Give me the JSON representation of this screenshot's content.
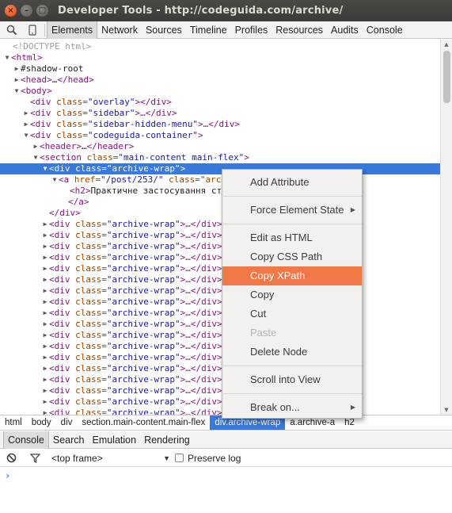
{
  "window": {
    "title": "Developer Tools - http://codeguida.com/archive/",
    "close_glyph": "×",
    "min_glyph": "–",
    "max_glyph": "□"
  },
  "toolbar": {
    "icons": [
      "search-icon",
      "device-mode-icon"
    ],
    "tabs": [
      "Elements",
      "Network",
      "Sources",
      "Timeline",
      "Profiles",
      "Resources",
      "Audits",
      "Console"
    ],
    "active_tab": "Elements"
  },
  "dom_tree": {
    "r0": {
      "a": "",
      "p1": "<!DOCTYPE html>"
    },
    "r1": {
      "a": "▼",
      "p1": "<html>"
    },
    "r2": {
      "a": "▶",
      "p1": "#shadow-root"
    },
    "r3": {
      "a": "▶",
      "p1": "<head>",
      "p2": "…",
      "p3": "</head>"
    },
    "r4": {
      "a": "▼",
      "p1": "<body>"
    },
    "r5": {
      "a": "",
      "p1": "<div ",
      "p2": "class=",
      "p3": "\"overlay\"",
      "p4": "></div>"
    },
    "r6": {
      "a": "▶",
      "p1": "<div ",
      "p2": "class=",
      "p3": "\"sidebar\"",
      "p4": ">…</div>"
    },
    "r7": {
      "a": "▶",
      "p1": "<div ",
      "p2": "class=",
      "p3": "\"sidebar-hidden-menu\"",
      "p4": ">…</div>"
    },
    "r8": {
      "a": "▼",
      "p1": "<div ",
      "p2": "class=",
      "p3": "\"codeguida-container\"",
      "p4": ">"
    },
    "r9": {
      "a": "▶",
      "p1": "<header>",
      "p2": "…",
      "p3": "</header>"
    },
    "r10": {
      "a": "▼",
      "p1": "<section ",
      "p2": "class=",
      "p3": "\"main-content main-flex\"",
      "p4": ">"
    },
    "r11": {
      "a": "▼",
      "p1": "<div ",
      "p2": "class=",
      "p3": "\"archive-wrap\"",
      "p4": ">"
    },
    "r12": {
      "a": "▼",
      "p1": "<a ",
      "p2": "href=",
      "p3": "\"/post/253/\"",
      "p4": " class=\"arc"
    },
    "r13": {
      "a": "",
      "p1": "<h2>",
      "p2": "Практичне застосування ст"
    },
    "r14": {
      "a": "",
      "p1": "</a>"
    },
    "r15": {
      "a": "",
      "p1": "</div>"
    },
    "collapsed_row": {
      "a": "▶",
      "p1": "<div ",
      "p2": "class=",
      "p3": "\"archive-wrap\"",
      "p4": ">…</div>"
    },
    "collapsed_count": 19
  },
  "breadcrumbs": [
    "html",
    "body",
    "div",
    "section.main-content.main-flex",
    "div.archive-wrap",
    "a.archive-a",
    "h2"
  ],
  "breadcrumb_selected": "div.archive-wrap",
  "context_menu": {
    "items": [
      "Add Attribute",
      "Force Element State",
      "Edit as HTML",
      "Copy CSS Path",
      "Copy XPath",
      "Copy",
      "Cut",
      "Paste",
      "Delete Node",
      "Scroll into View",
      "Break on..."
    ],
    "highlighted": "Copy XPath",
    "disabled": [
      "Paste"
    ],
    "submenu_items": [
      "Force Element State",
      "Break on..."
    ],
    "submenu_arrow": "▶"
  },
  "drawer": {
    "tabs": [
      "Console",
      "Search",
      "Emulation",
      "Rendering"
    ],
    "active_tab": "Console"
  },
  "console": {
    "icons": [
      "clear-console-icon",
      "filter-icon"
    ],
    "frame_select": "<top frame>",
    "dropdown_glyph": "▼",
    "preserve_log_label": "Preserve log",
    "preserve_log_checked": false,
    "prompt": "›"
  },
  "colors": {
    "selection": "#3879d9",
    "menu_highlight": "#f07746",
    "tag": "#881280",
    "attr_name": "#994500",
    "attr_value": "#1a1aa6",
    "prompt": "#2f7df6"
  }
}
